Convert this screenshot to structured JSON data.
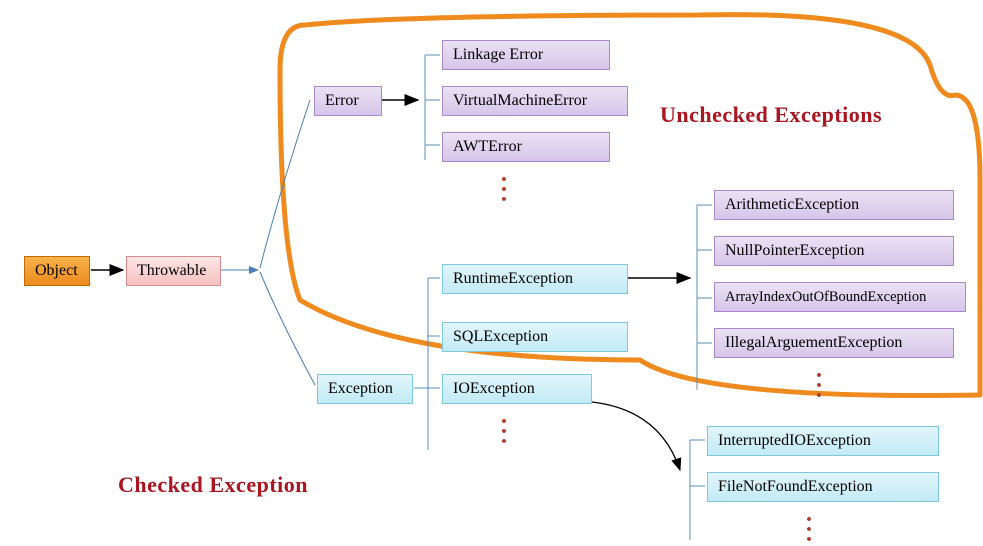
{
  "nodes": {
    "object": "Object",
    "throwable": "Throwable",
    "error": "Error",
    "linkageError": "Linkage Error",
    "virtualMachineError": "VirtualMachineError",
    "awtError": "AWTError",
    "exception": "Exception",
    "runtimeException": "RuntimeException",
    "sqlException": "SQLException",
    "ioException": "IOException",
    "arithmeticException": "ArithmeticException",
    "nullPointerException": "NullPointerException",
    "arrayIndexException": "ArrayIndexOutOfBoundException",
    "illegalArgException": "IllegalArguementException",
    "interruptedIOException": "InterruptedIOException",
    "fileNotFoundException": "FileNotFoundException"
  },
  "labels": {
    "unchecked": "Unchecked Exceptions",
    "checked": "Checked Exception"
  },
  "ellipsis": "..."
}
